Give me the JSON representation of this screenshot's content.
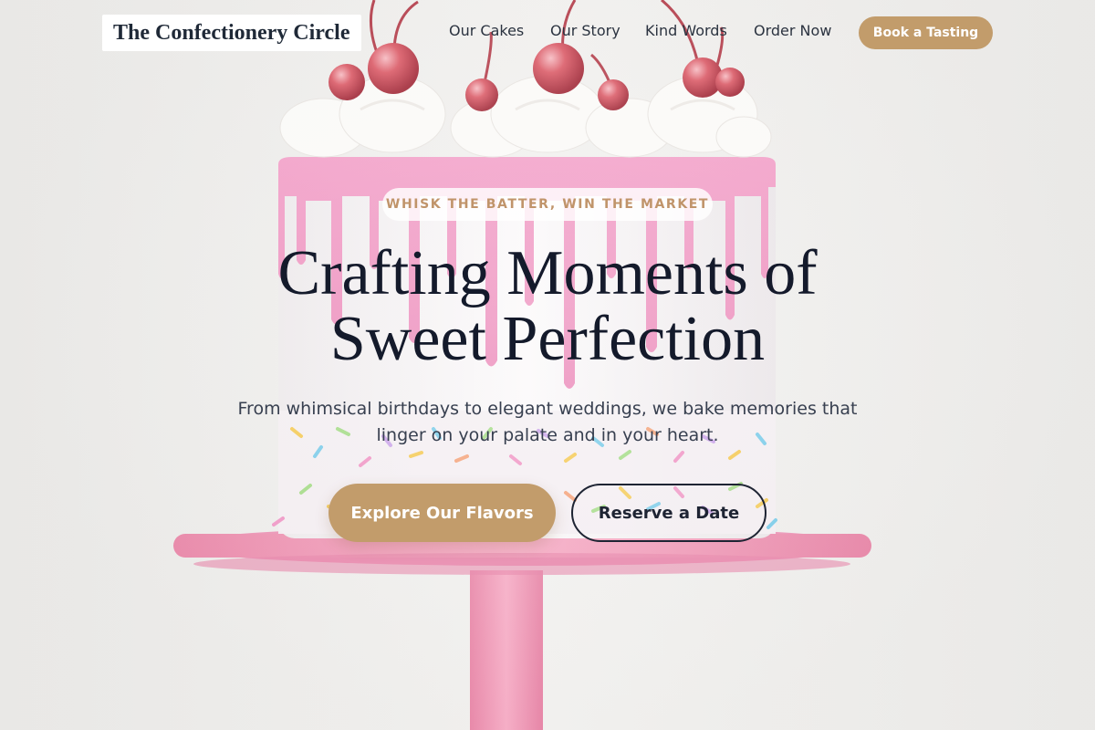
{
  "brand": {
    "name": "The Confectionery Circle"
  },
  "nav": {
    "items": [
      {
        "label": "Our Cakes"
      },
      {
        "label": "Our Story"
      },
      {
        "label": "Kind Words"
      },
      {
        "label": "Order Now"
      }
    ],
    "cta_label": "Book a Tasting"
  },
  "hero": {
    "eyebrow": "WHISK THE BATTER, WIN THE MARKET",
    "headline_line1": "Crafting Moments of",
    "headline_line2": "Sweet Perfection",
    "subtitle": "From whimsical birthdays to elegant weddings, we bake memories that linger on your palate and in your heart.",
    "primary_button": "Explore Our Flavors",
    "secondary_button": "Reserve a Date"
  },
  "colors": {
    "accent": "#c29c6b",
    "ink": "#141a2b",
    "frosting_pink": "#ee8fbd",
    "stand_pink": "#f09ab8"
  }
}
